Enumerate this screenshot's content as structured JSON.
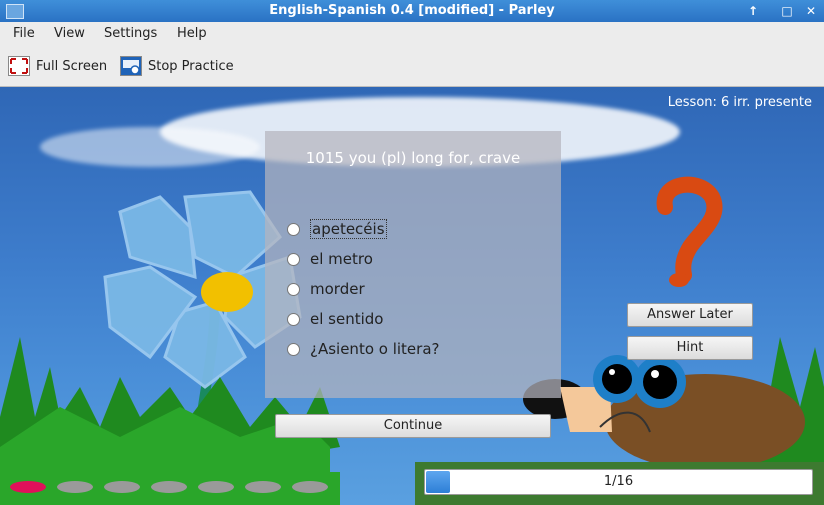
{
  "window": {
    "title": "English-Spanish 0.4 [modified] - Parley"
  },
  "menu": [
    "File",
    "View",
    "Settings",
    "Help"
  ],
  "toolbar": {
    "fullscreen": "Full Screen",
    "stop": "Stop Practice"
  },
  "lesson_label": "Lesson: 6 irr. presente",
  "question": "1015 you (pl) long for, crave",
  "options": [
    "apetecéis",
    "el metro",
    "morder",
    "el sentido",
    "¿Asiento o litera?"
  ],
  "buttons": {
    "answer_later": "Answer Later",
    "hint": "Hint",
    "continue": "Continue"
  },
  "progress": {
    "label": "1/16",
    "fraction": 0.0625
  },
  "dots": {
    "count": 7,
    "active_index": 0
  },
  "colors": {
    "titlebar": "#2a72c4",
    "accent_question": "#d94a12",
    "flower_center": "#f2c000",
    "active_dot": "#e0105a"
  },
  "icons": {
    "fullscreen": "fullscreen-icon",
    "stop": "stop-practice-icon",
    "question_mark": "question-mark-icon"
  }
}
